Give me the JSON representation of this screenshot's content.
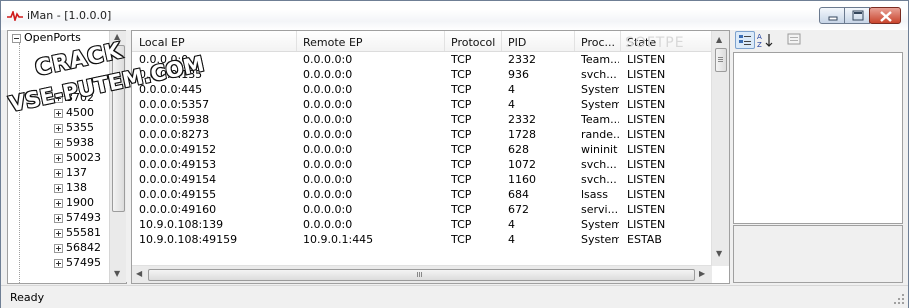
{
  "window": {
    "title": "iMan - [1.0.0.0]"
  },
  "tree": {
    "root_label": "OpenPorts",
    "items": [
      "3702",
      "4500",
      "5355",
      "5938",
      "50023",
      "137",
      "138",
      "1900",
      "57493",
      "55581",
      "56842",
      "57495"
    ]
  },
  "list": {
    "columns": [
      "Local EP",
      "Remote EP",
      "Protocol",
      "PID",
      "Proc...",
      "State"
    ],
    "rows": [
      [
        "0.0.0.0:0",
        "0.0.0.0:0",
        "TCP",
        "2332",
        "Team...",
        "LISTEN"
      ],
      [
        "0.0.0.0:135",
        "0.0.0.0:0",
        "TCP",
        "936",
        "svch...",
        "LISTEN"
      ],
      [
        "0.0.0.0:445",
        "0.0.0.0:0",
        "TCP",
        "4",
        "System",
        "LISTEN"
      ],
      [
        "0.0.0.0:5357",
        "0.0.0.0:0",
        "TCP",
        "4",
        "System",
        "LISTEN"
      ],
      [
        "0.0.0.0:5938",
        "0.0.0.0:0",
        "TCP",
        "2332",
        "Team...",
        "LISTEN"
      ],
      [
        "0.0.0.0:8273",
        "0.0.0.0:0",
        "TCP",
        "1728",
        "rande...",
        "LISTEN"
      ],
      [
        "0.0.0.0:49152",
        "0.0.0.0:0",
        "TCP",
        "628",
        "wininit",
        "LISTEN"
      ],
      [
        "0.0.0.0:49153",
        "0.0.0.0:0",
        "TCP",
        "1072",
        "svch...",
        "LISTEN"
      ],
      [
        "0.0.0.0:49154",
        "0.0.0.0:0",
        "TCP",
        "1160",
        "svch...",
        "LISTEN"
      ],
      [
        "0.0.0.0:49155",
        "0.0.0.0:0",
        "TCP",
        "684",
        "lsass",
        "LISTEN"
      ],
      [
        "0.0.0.0:49160",
        "0.0.0.0:0",
        "TCP",
        "672",
        "servi...",
        "LISTEN"
      ],
      [
        "10.9.0.108:139",
        "0.0.0.0:0",
        "TCP",
        "4",
        "System",
        "LISTEN"
      ],
      [
        "10.9.0.108:49159",
        "10.9.0.1:445",
        "TCP",
        "4",
        "System",
        "ESTAB"
      ]
    ]
  },
  "status": {
    "text": "Ready"
  },
  "watermark": {
    "line1": "CRACK",
    "line2": "VSE-PUTEM.COM",
    "faded": "SOFTPE"
  },
  "icons": {
    "app": "app-icon",
    "minimize": "minimize-icon",
    "maximize": "maximize-icon",
    "close": "close-icon",
    "categorized": "categorized-icon",
    "alphabetical": "alphabetical-sort-icon",
    "property_pages": "property-pages-icon"
  },
  "colors": {
    "close_button": "#c9442c",
    "selection_border": "#7da2ce",
    "frame": "#6f7f95"
  }
}
